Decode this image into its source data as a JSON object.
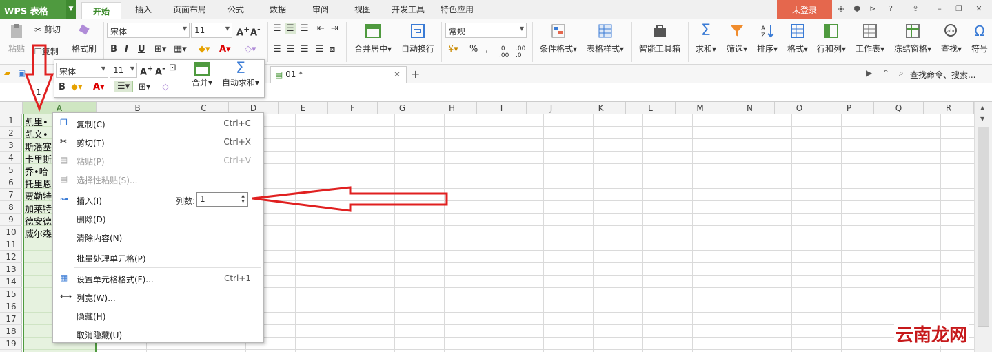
{
  "app": {
    "name": "WPS 表格"
  },
  "tabs": [
    "开始",
    "插入",
    "页面布局",
    "公式",
    "数据",
    "审阅",
    "视图",
    "开发工具",
    "特色应用"
  ],
  "login_label": "未登录",
  "ribbon": {
    "paste": "粘贴",
    "cut": "剪切",
    "copy": "复制",
    "format_painter": "格式刷",
    "font_name": "宋体",
    "font_size": "11",
    "merge_center": "合并居中",
    "wrap_text": "自动换行",
    "number_format": "常规",
    "conditional_format": "条件格式",
    "table_style": "表格样式",
    "smart_toolbox": "智能工具箱",
    "sum": "求和",
    "filter": "筛选",
    "sort": "排序",
    "format": "格式",
    "row_col": "行和列",
    "worksheet": "工作表",
    "freeze": "冻结窗格",
    "find": "查找",
    "symbol": "符号"
  },
  "document_tab": "01 *",
  "search_placeholder": "查找命令、搜索...",
  "name_box": "1",
  "mini_toolbar": {
    "font_name": "宋体",
    "font_size": "11",
    "merge": "合并",
    "autosum": "自动求和"
  },
  "columns": [
    "A",
    "B",
    "C",
    "D",
    "E",
    "F",
    "G",
    "H",
    "I",
    "J",
    "K",
    "L",
    "M",
    "N",
    "O",
    "P",
    "Q",
    "R"
  ],
  "rows": [
    "1",
    "2",
    "3",
    "4",
    "5",
    "6",
    "7",
    "8",
    "9",
    "10",
    "11",
    "12",
    "13",
    "14",
    "15",
    "16",
    "17",
    "18",
    "19"
  ],
  "cells_col_a": [
    "凯里•",
    "凯文•",
    "斯潘塞",
    "卡里斯",
    "乔•哈",
    "托里恩",
    "贾勒特",
    "加莱特",
    "德安德",
    "威尔森"
  ],
  "context_menu": {
    "items": [
      {
        "label": "复制(C)",
        "shortcut": "Ctrl+C",
        "icon": "copy-icon",
        "enabled": true
      },
      {
        "label": "剪切(T)",
        "shortcut": "Ctrl+X",
        "icon": "scissors-icon",
        "enabled": true
      },
      {
        "label": "粘贴(P)",
        "shortcut": "Ctrl+V",
        "icon": "paste-icon",
        "enabled": false
      },
      {
        "label": "选择性粘贴(S)...",
        "shortcut": "",
        "icon": "paste-special-icon",
        "enabled": false
      },
      {
        "label": "插入(I)",
        "shortcut": "",
        "icon": "insert-icon",
        "enabled": true
      },
      {
        "label": "删除(D)",
        "shortcut": "",
        "icon": "",
        "enabled": true
      },
      {
        "label": "清除内容(N)",
        "shortcut": "",
        "icon": "",
        "enabled": true
      },
      {
        "label": "批量处理单元格(P)",
        "shortcut": "",
        "icon": "",
        "enabled": true
      },
      {
        "label": "设置单元格格式(F)...",
        "shortcut": "Ctrl+1",
        "icon": "format-cells-icon",
        "enabled": true
      },
      {
        "label": "列宽(W)...",
        "shortcut": "",
        "icon": "column-width-icon",
        "enabled": true
      },
      {
        "label": "隐藏(H)",
        "shortcut": "",
        "icon": "",
        "enabled": true
      },
      {
        "label": "取消隐藏(U)",
        "shortcut": "",
        "icon": "",
        "enabled": true
      }
    ],
    "column_count_label": "列数:",
    "column_count_value": "1"
  },
  "watermark": "云南龙网",
  "colors": {
    "accent": "#4f9a3f",
    "login": "#e5674d",
    "arrow": "#e02020"
  }
}
